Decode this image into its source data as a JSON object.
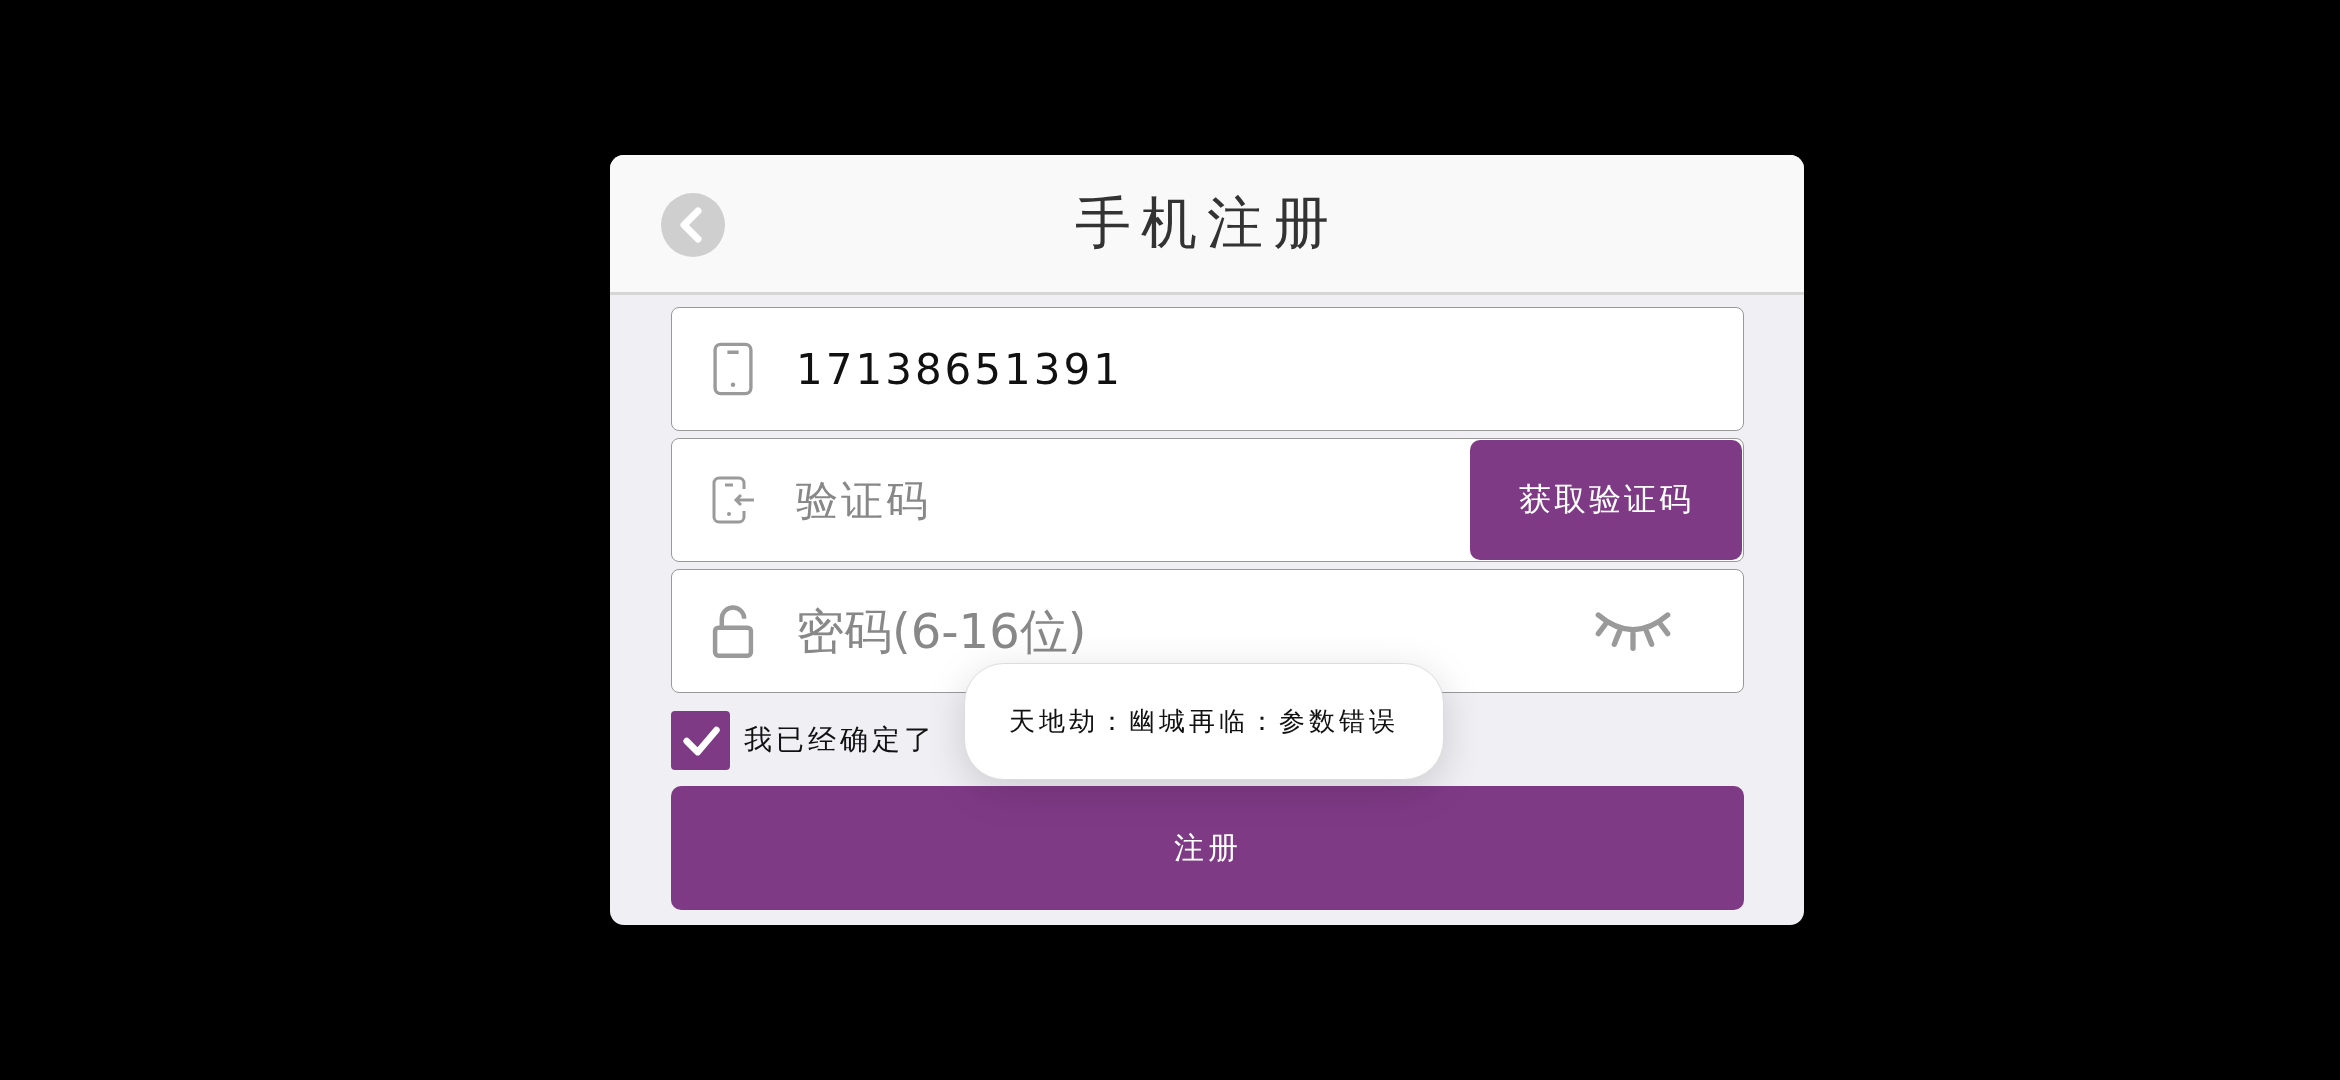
{
  "header": {
    "title": "手机注册"
  },
  "phone_field": {
    "value": "17138651391"
  },
  "code_field": {
    "placeholder": "验证码",
    "button": "获取验证码"
  },
  "password_field": {
    "placeholder": "密码(6-16位)",
    "visible": false
  },
  "agreement": {
    "checked": true,
    "text": "我已经确定了"
  },
  "register_button": "注册",
  "toast": "天地劫：幽城再临：参数错误"
}
